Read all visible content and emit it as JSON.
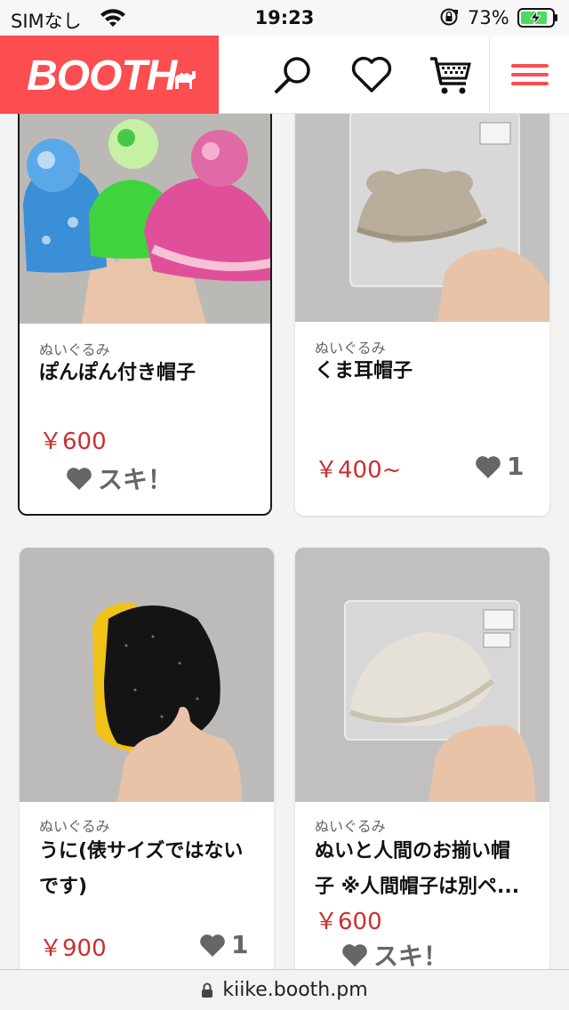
{
  "status_bar": {
    "carrier": "SIMなし",
    "time": "19:23",
    "battery_percent": "73%"
  },
  "header": {
    "logo_text": "BOOTH",
    "brand_color": "#fc4d50",
    "icons": [
      "search-icon",
      "heart-icon",
      "cart-icon",
      "hamburger-menu-icon"
    ]
  },
  "items": [
    {
      "category": "ぬいぐるみ",
      "title": "ぽんぽん付き帽子",
      "price": "￥600",
      "like_label": "スキ！",
      "selected": true
    },
    {
      "category": "ぬいぐるみ",
      "title": "くま耳帽子",
      "price": "￥400~",
      "like_count": "1"
    },
    {
      "category": "ぬいぐるみ",
      "title": "うに(俵サイズではないです)",
      "title_line1": "うに(俵サイズではない",
      "title_line2": "です)",
      "price": "￥900",
      "like_count": "1"
    },
    {
      "category": "ぬいぐるみ",
      "title": "ぬいと人間のお揃い帽子 ※人間帽子は別ペ...",
      "title_line1": "ぬいと人間のお揃い帽",
      "title_line2": "子 ※人間帽子は別ペ...",
      "price": "￥600",
      "like_label": "スキ！"
    }
  ],
  "url_bar": {
    "url": "kiike.booth.pm"
  }
}
